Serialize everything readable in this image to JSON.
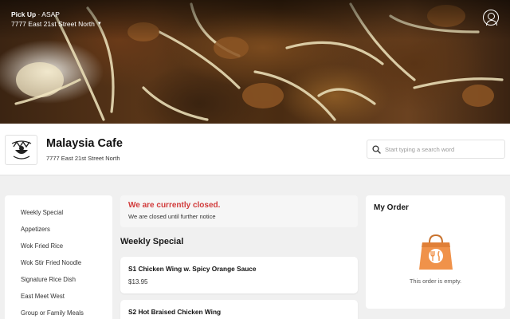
{
  "pickup": {
    "mode": "Pick Up",
    "separator": " · ",
    "timing": "ASAP",
    "address": "7777 East 21st Street North",
    "caret_icon": "triangle-down"
  },
  "restaurant": {
    "name": "Malaysia Cafe",
    "address": "7777 East 21st Street North",
    "logo_text": "Malaysia Cafe"
  },
  "search": {
    "placeholder": "Start typing a search word",
    "value": ""
  },
  "sidebar": {
    "items": [
      {
        "label": "Weekly Special"
      },
      {
        "label": "Appetizers"
      },
      {
        "label": "Wok Fried Rice"
      },
      {
        "label": "Wok Stir Fried Noodle"
      },
      {
        "label": "Signature Rice Dish"
      },
      {
        "label": "East Meet West"
      },
      {
        "label": "Group or Family Meals"
      }
    ]
  },
  "notice": {
    "title": "We are currently closed.",
    "subtitle": "We are closed until further notice"
  },
  "menu": {
    "section_title": "Weekly Special",
    "items": [
      {
        "name": "S1 Chicken Wing w. Spicy Orange Sauce",
        "price": "$13.95"
      },
      {
        "name": "S2 Hot Braised Chicken Wing",
        "price": ""
      }
    ]
  },
  "order": {
    "title": "My Order",
    "empty_text": "This order is empty."
  },
  "colors": {
    "closed_red": "#d13b3b",
    "bag_orange": "#f0924a"
  }
}
